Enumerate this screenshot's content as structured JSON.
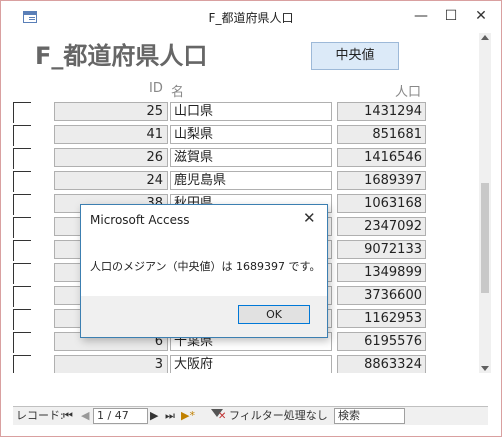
{
  "window": {
    "title": "F_都道府県人口",
    "minimize": "—",
    "maximize": "☐",
    "close": "✕"
  },
  "form": {
    "heading": "F_都道府県人口",
    "median_button": "中央値",
    "columns": {
      "id": "ID",
      "name": "名",
      "population": "人口"
    },
    "rows": [
      {
        "id": "25",
        "name": "山口県",
        "population": "1431294"
      },
      {
        "id": "41",
        "name": "山梨県",
        "population": "851681"
      },
      {
        "id": "26",
        "name": "滋賀県",
        "population": "1416546"
      },
      {
        "id": "24",
        "name": "鹿児島県",
        "population": "1689397"
      },
      {
        "id": "38",
        "name": "秋田県",
        "population": "1063168"
      },
      {
        "id": "",
        "name": "",
        "population": "2347092"
      },
      {
        "id": "",
        "name": "",
        "population": "9072133"
      },
      {
        "id": "",
        "name": "",
        "population": "1349899"
      },
      {
        "id": "",
        "name": "",
        "population": "3736600"
      },
      {
        "id": "",
        "name": "",
        "population": "1162953"
      },
      {
        "id": "6",
        "name": "千葉県",
        "population": "6195576"
      },
      {
        "id": "3",
        "name": "大阪府",
        "population": "8863324"
      }
    ]
  },
  "navigation": {
    "record_label": "レコード:",
    "first": "⏮",
    "prev": "◀",
    "position": "1 / 47",
    "next": "▶",
    "last": "⏭",
    "new": "▶*",
    "filter_label": "フィルター処理なし",
    "search_placeholder": "検索"
  },
  "dialog": {
    "title": "Microsoft Access",
    "close": "✕",
    "message": "人口のメジアン（中央値）は 1689397 です。",
    "ok_label": "OK"
  }
}
